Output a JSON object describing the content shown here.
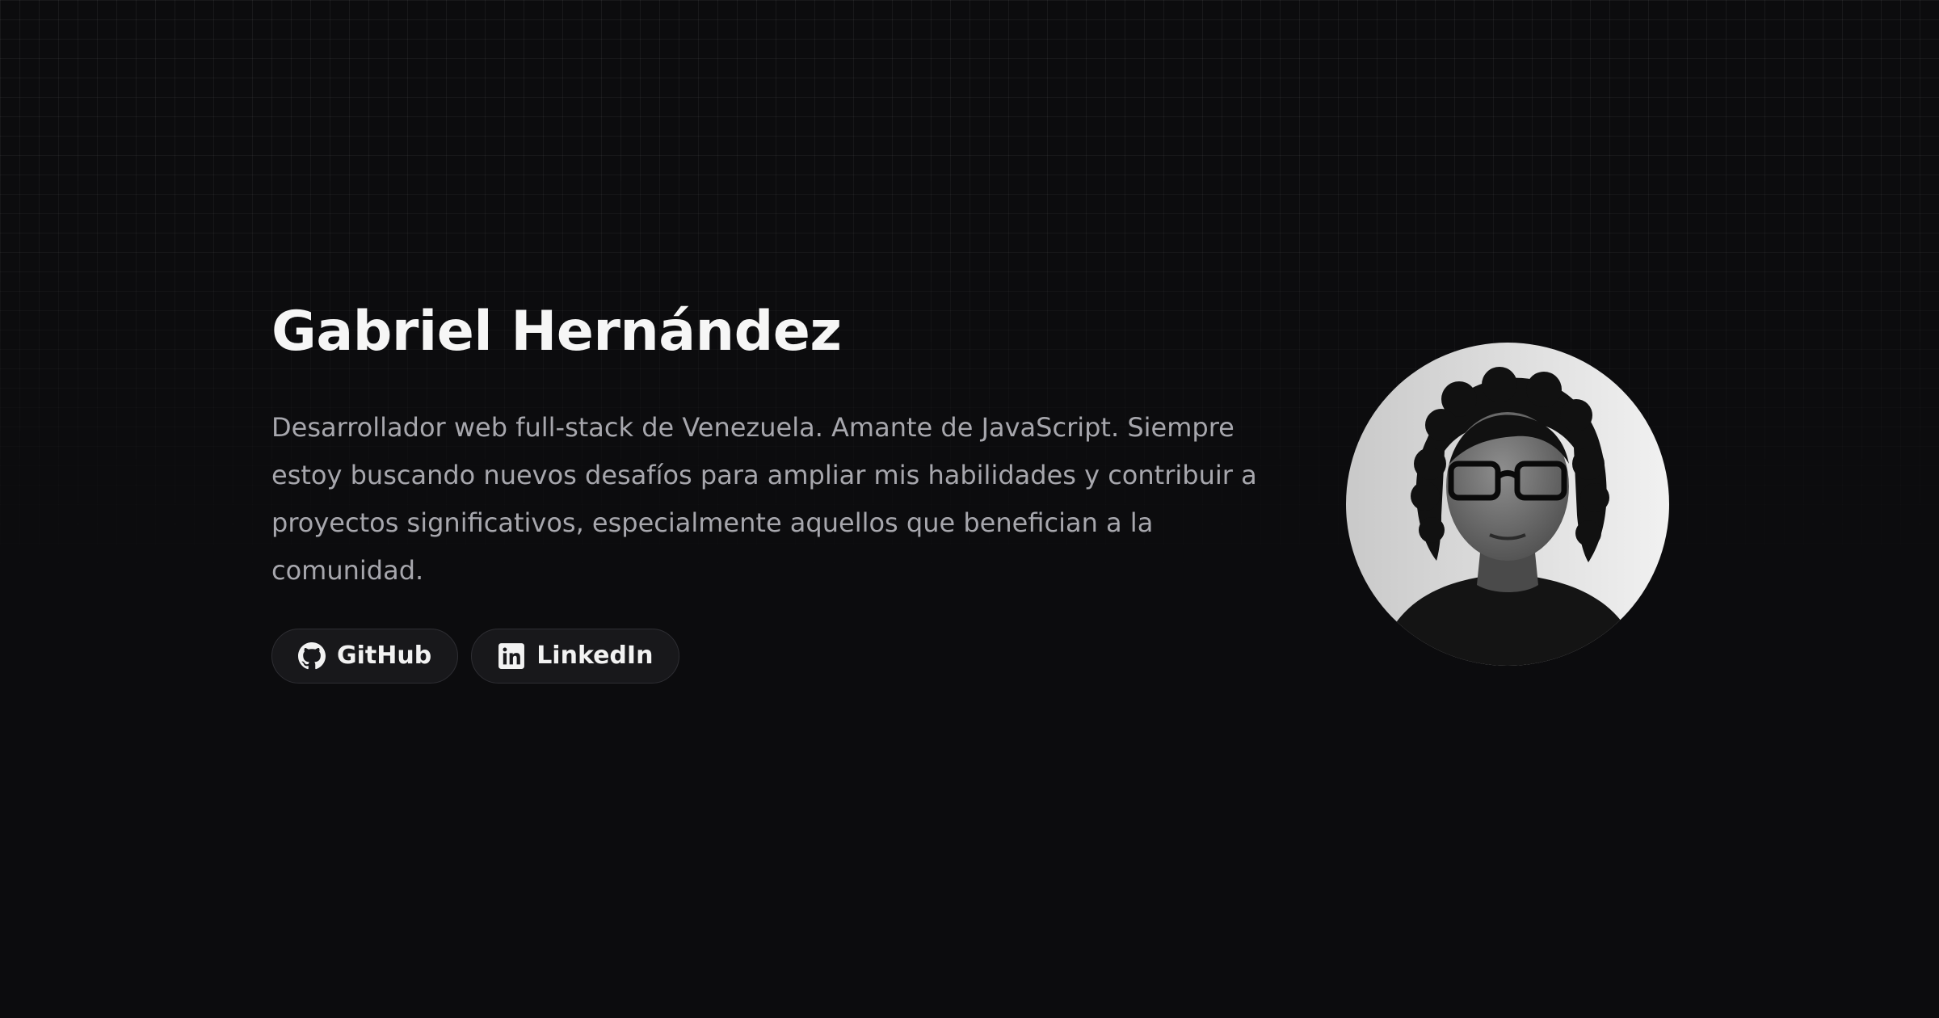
{
  "profile": {
    "name": "Gabriel Hernández",
    "bio": "Desarrollador web full-stack de Venezuela. Amante de JavaScript. Siempre estoy buscando nuevos desafíos para ampliar mis habilidades y contribuir a proyectos significativos, especialmente aquellos que benefician a la comunidad.",
    "avatar_alt": "Gabriel Hernández"
  },
  "links": {
    "github": {
      "label": "GitHub",
      "icon": "github-icon"
    },
    "linkedin": {
      "label": "LinkedIn",
      "icon": "linkedin-icon"
    }
  },
  "theme": {
    "background": "#0c0c0e",
    "text_primary": "#f6f6f6",
    "text_secondary": "#a7a7ad",
    "pill_background": "#18181b",
    "pill_border": "#2e2e33"
  }
}
